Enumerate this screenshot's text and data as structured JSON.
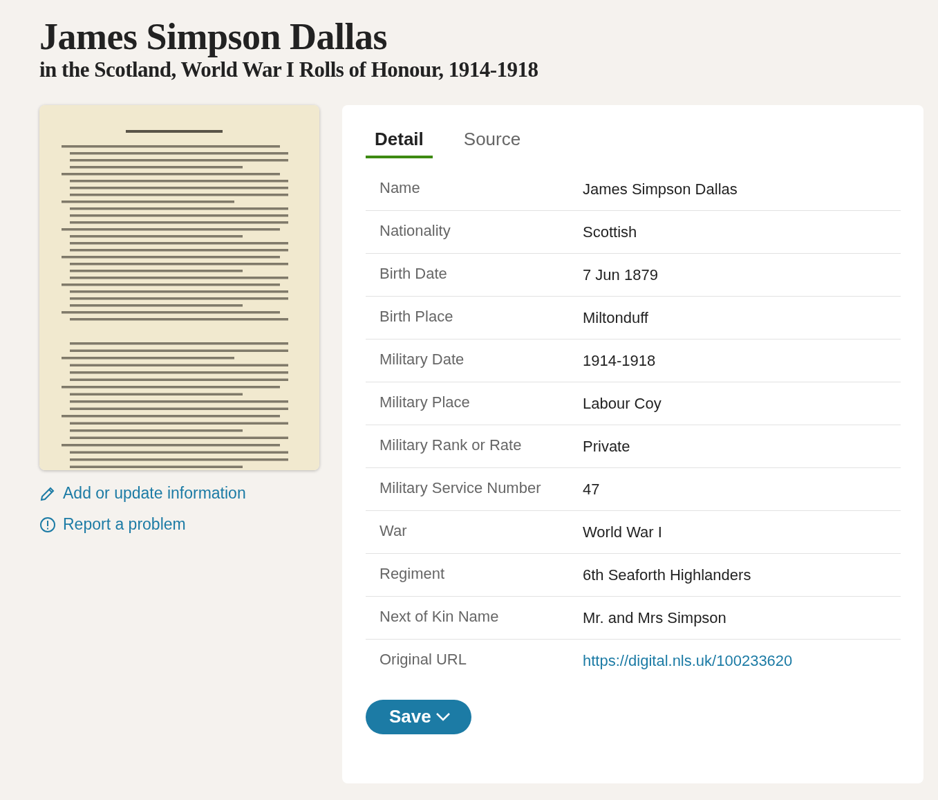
{
  "title": "James Simpson Dallas",
  "subtitle": "in the Scotland, World War I Rolls of Honour, 1914-1918",
  "actions": [
    {
      "kind": "edit",
      "label": "Add or update information"
    },
    {
      "kind": "report",
      "label": "Report a problem"
    }
  ],
  "tabs": [
    {
      "label": "Detail",
      "selected": true
    },
    {
      "label": "Source",
      "selected": false
    }
  ],
  "details": [
    {
      "label": "Name",
      "value": "James Simpson Dallas"
    },
    {
      "label": "Nationality",
      "value": "Scottish"
    },
    {
      "label": "Birth Date",
      "value": "7 Jun 1879"
    },
    {
      "label": "Birth Place",
      "value": "Miltonduff"
    },
    {
      "label": "Military Date",
      "value": "1914-1918"
    },
    {
      "label": "Military Place",
      "value": "Labour Coy"
    },
    {
      "label": "Military Rank or Rate",
      "value": "Private"
    },
    {
      "label": "Military Service Number",
      "value": "47"
    },
    {
      "label": "War",
      "value": "World War I"
    },
    {
      "label": "Regiment",
      "value": "6th Seaforth Highlanders"
    },
    {
      "label": "Next of Kin Name",
      "value": "Mr. and Mrs Simpson"
    },
    {
      "label": "Original URL",
      "value": "https://digital.nls.uk/100233620",
      "kind": "link"
    }
  ],
  "save_button": {
    "label": "Save"
  }
}
